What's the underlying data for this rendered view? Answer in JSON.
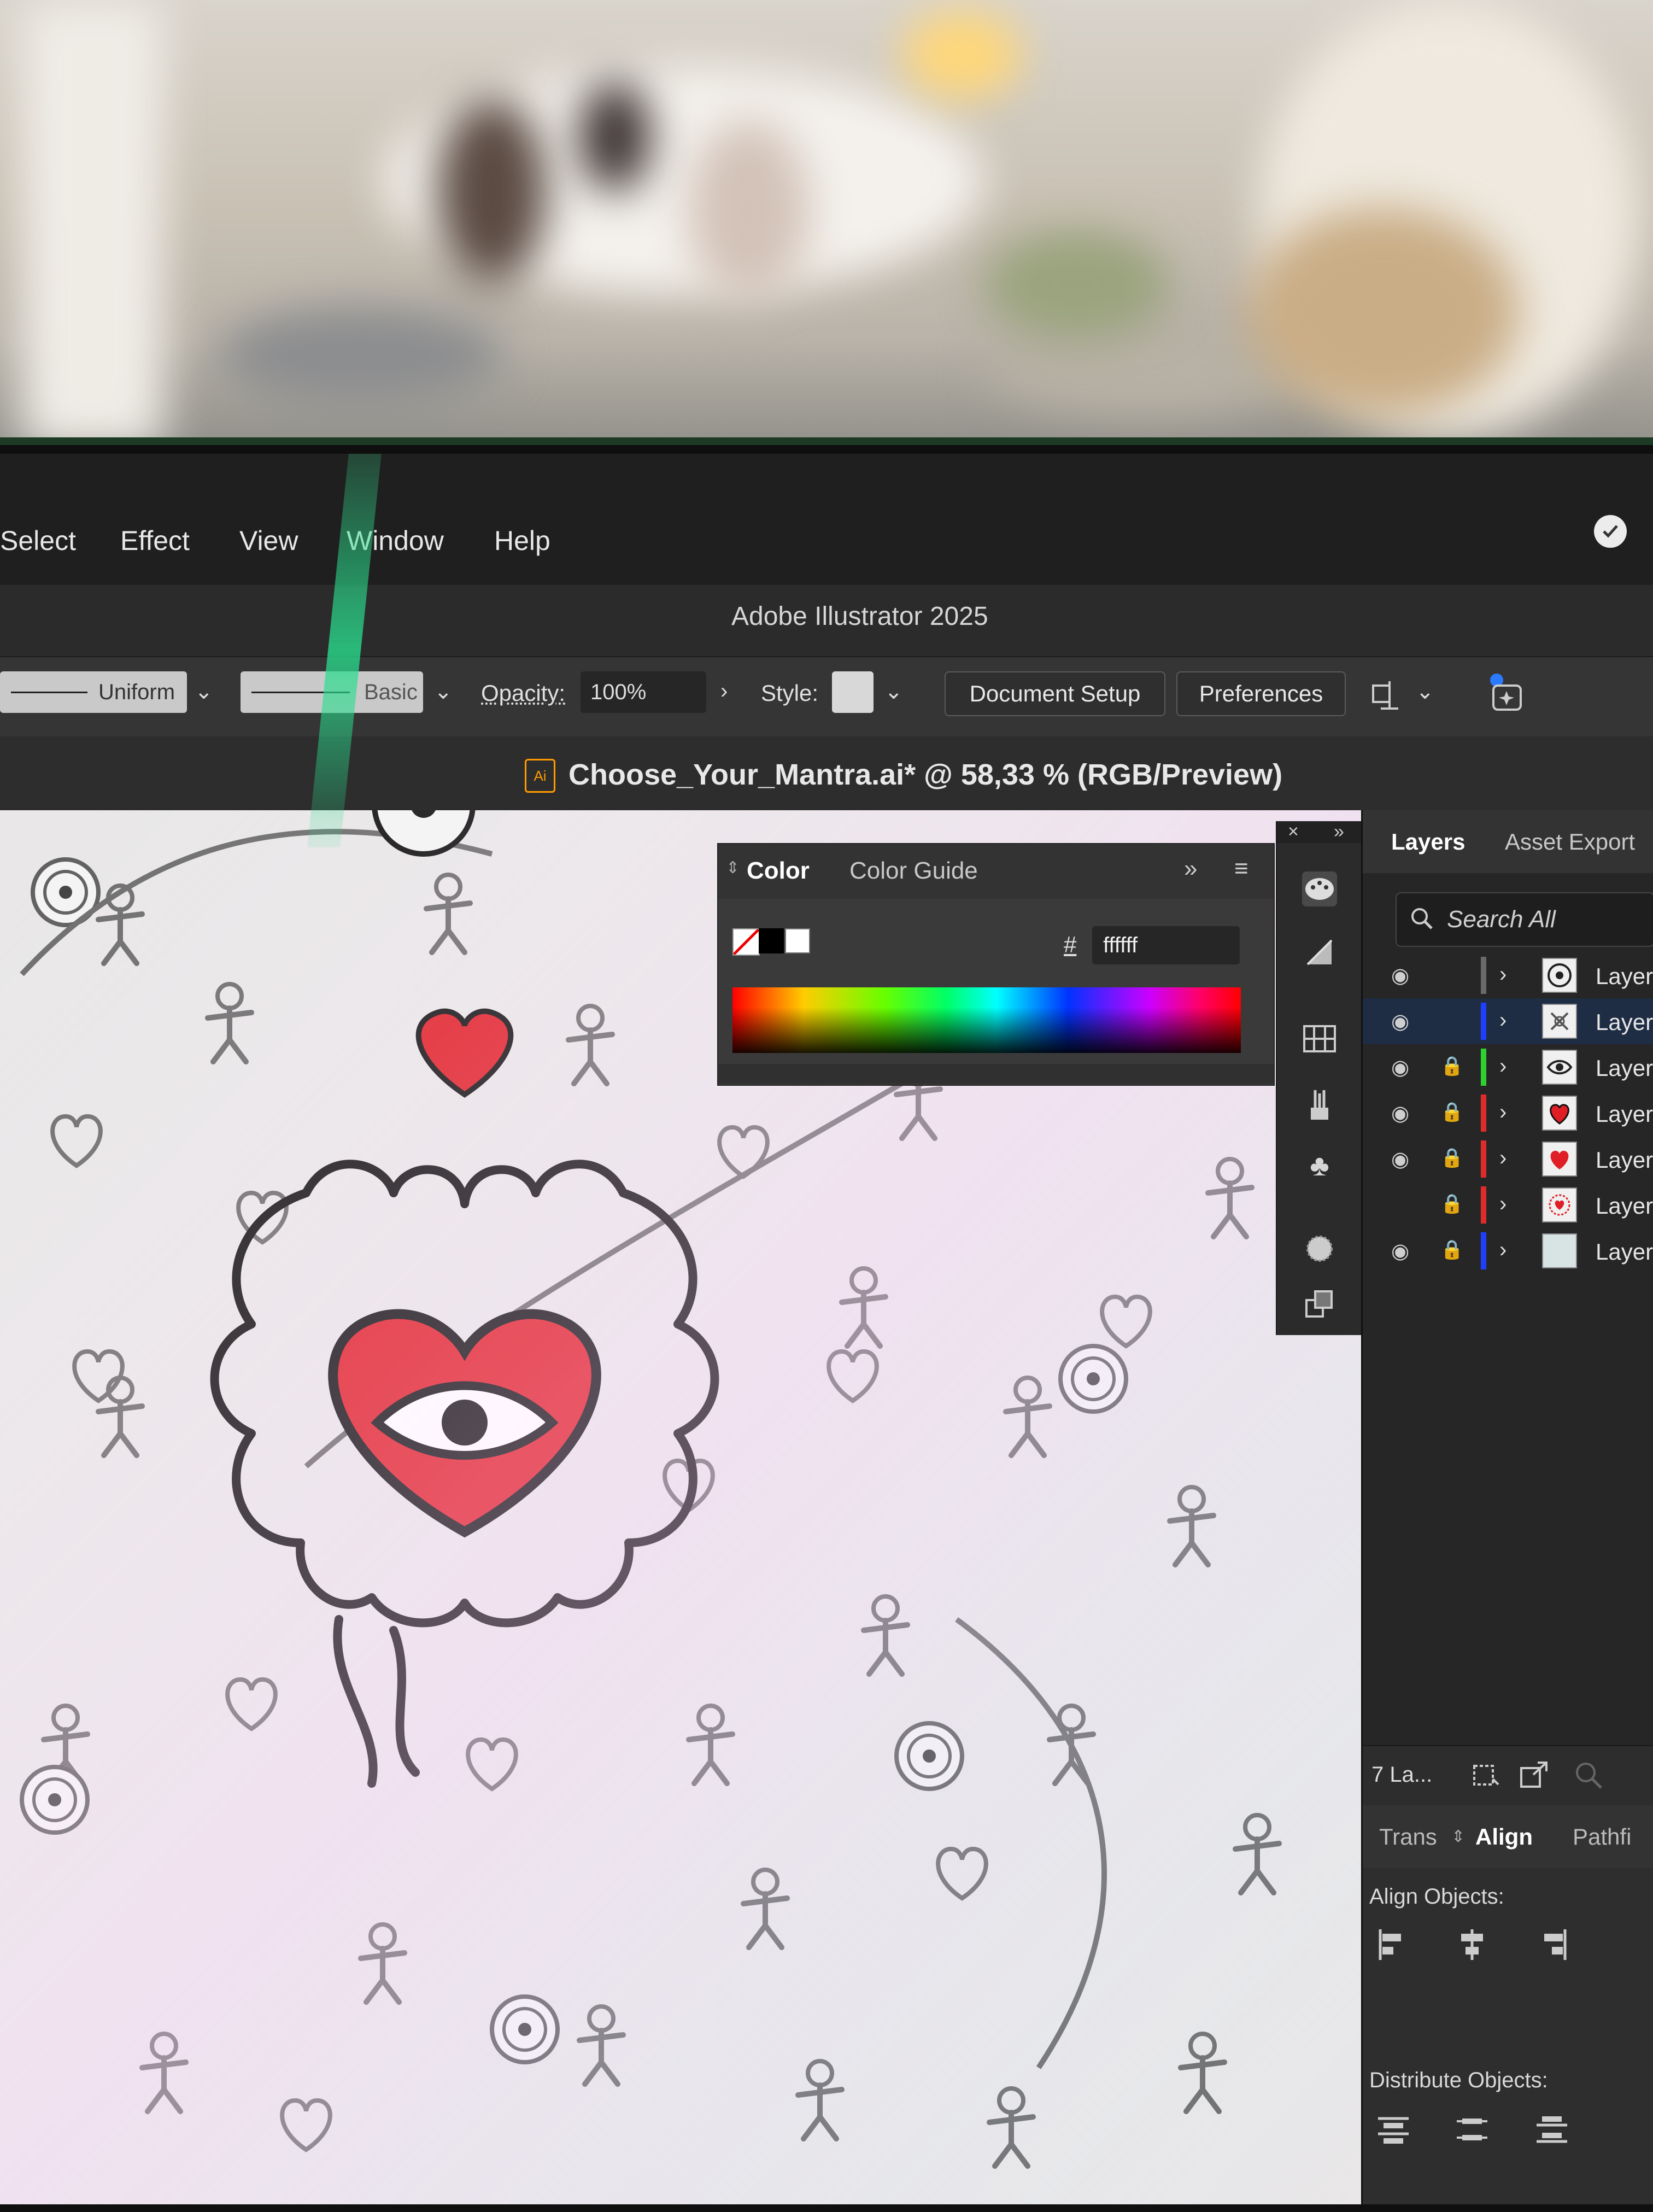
{
  "menu": {
    "items": [
      "Select",
      "Effect",
      "View",
      "Window",
      "Help"
    ]
  },
  "app_title": "Adobe Illustrator 2025",
  "control_bar": {
    "stroke_profile": "Uniform",
    "brush": "Basic",
    "opacity_label": "Opacity:",
    "opacity_value": "100%",
    "style_label": "Style:",
    "document_setup": "Document Setup",
    "preferences": "Preferences"
  },
  "document": {
    "icon_label": "Ai",
    "title": "Choose_Your_Mantra.ai* @ 58,33 % (RGB/Preview)"
  },
  "color_panel": {
    "tabs": [
      "Color",
      "Color Guide"
    ],
    "hex_symbol": "#",
    "hex_value": "ffffff"
  },
  "layers_panel": {
    "tabs": [
      "Layers",
      "Asset Export"
    ],
    "search_placeholder": "Search All",
    "layers": [
      {
        "name": "Layer",
        "visible": true,
        "locked": false,
        "color": "#6a6a6a",
        "thumb": "sun-eye"
      },
      {
        "name": "Layer",
        "visible": true,
        "locked": false,
        "color": "#1f3fff",
        "thumb": "figures"
      },
      {
        "name": "Layer",
        "visible": true,
        "locked": true,
        "color": "#2fd12f",
        "thumb": "eye"
      },
      {
        "name": "Layer",
        "visible": true,
        "locked": true,
        "color": "#e02b2b",
        "thumb": "red-heart"
      },
      {
        "name": "Layer",
        "visible": true,
        "locked": true,
        "color": "#e02b2b",
        "thumb": "red-heart"
      },
      {
        "name": "Layer",
        "visible": false,
        "locked": true,
        "color": "#e02b2b",
        "thumb": "heart-pattern"
      },
      {
        "name": "Layer",
        "visible": true,
        "locked": true,
        "color": "#1f3fff",
        "thumb": "background"
      }
    ],
    "count_label": "7 La..."
  },
  "align_panel": {
    "tabs": [
      "Trans",
      "Align",
      "Pathfi"
    ],
    "align_objects_label": "Align Objects:",
    "distribute_objects_label": "Distribute Objects:"
  }
}
